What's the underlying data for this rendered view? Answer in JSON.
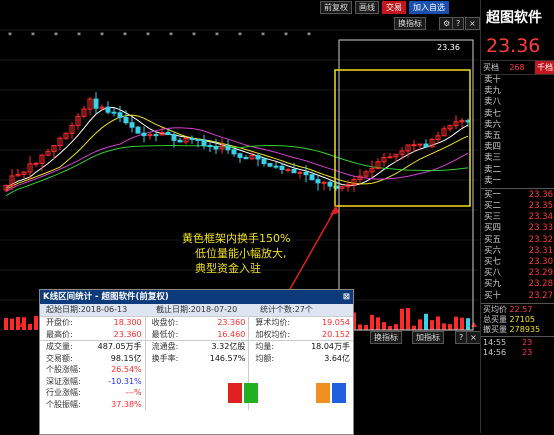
{
  "toolbar": {
    "fq": "前复权",
    "draw": "画线",
    "trade": "交易",
    "add_watch": "加入自选",
    "swap_top": "换指标",
    "swap_bottom": "换指标",
    "add_bottom": "加指标",
    "q": "?",
    "x": "×"
  },
  "chart": {
    "top_price": "23.36",
    "annotation_line1": "黄色框架内换手150%",
    "annotation_line2": "低位量能小幅放大,",
    "annotation_line3": "典型资金入驻"
  },
  "stock": {
    "name": "超图软件",
    "price": "23.36",
    "buy_label": "买档",
    "buy_count": "268",
    "buy_unit": "千档",
    "sells": [
      {
        "label": "卖十",
        "val": ""
      },
      {
        "label": "卖九",
        "val": ""
      },
      {
        "label": "卖八",
        "val": ""
      },
      {
        "label": "卖七",
        "val": ""
      },
      {
        "label": "卖六",
        "val": ""
      },
      {
        "label": "卖五",
        "val": ""
      },
      {
        "label": "卖四",
        "val": ""
      },
      {
        "label": "卖三",
        "val": ""
      },
      {
        "label": "卖二",
        "val": ""
      },
      {
        "label": "卖一",
        "val": ""
      }
    ],
    "buys": [
      {
        "label": "买一",
        "val": "23.36"
      },
      {
        "label": "买二",
        "val": "23.35"
      },
      {
        "label": "买三",
        "val": "23.34"
      },
      {
        "label": "买四",
        "val": "23.33"
      },
      {
        "label": "买五",
        "val": "23.32"
      },
      {
        "label": "买六",
        "val": "23.31"
      },
      {
        "label": "买七",
        "val": "23.30"
      },
      {
        "label": "买八",
        "val": "23.29"
      },
      {
        "label": "买九",
        "val": "23.28"
      },
      {
        "label": "买十",
        "val": "23.27"
      }
    ],
    "avg_buy_label": "买均价",
    "avg_buy": "22.57",
    "total_buy_label": "总买量",
    "total_buy": "27105",
    "withdraw_label": "撤买量",
    "withdraw": "278935",
    "ticks": [
      {
        "time": "14:55",
        "val": "23"
      },
      {
        "time": "14:56",
        "val": "23"
      }
    ]
  },
  "dialog": {
    "title": "K线区间统计 - 超图软件(前复权)",
    "start_date": "起始日期:2018-06-13",
    "end_date": "截止日期:2018-07-20",
    "count": "统计个数:27个",
    "col1": [
      {
        "k": "开盘价:",
        "v": "18.300",
        "c": "red"
      },
      {
        "k": "最高价:",
        "v": "23.360",
        "c": "red"
      },
      {
        "k": "成交量:",
        "v": "487.05万手",
        "c": "black"
      },
      {
        "k": "交易额:",
        "v": "98.15亿",
        "c": "black"
      },
      {
        "k": "个股涨幅:",
        "v": "26.54%",
        "c": "red"
      },
      {
        "k": "深证涨幅:",
        "v": "-10.31%",
        "c": "blue"
      },
      {
        "k": "行业涨幅:",
        "v": "---%",
        "c": "red"
      },
      {
        "k": "个股振幅:",
        "v": "37.38%",
        "c": "red"
      }
    ],
    "col2": [
      {
        "k": "收盘价:",
        "v": "23.360",
        "c": "red"
      },
      {
        "k": "最低价:",
        "v": "16.460",
        "c": "red"
      },
      {
        "k": "流通盘:",
        "v": "3.32亿股",
        "c": "black"
      },
      {
        "k": "换手率:",
        "v": "146.57%",
        "c": "black"
      }
    ],
    "col3": [
      {
        "k": "算术均价:",
        "v": "19.054",
        "c": "red"
      },
      {
        "k": "加权均价:",
        "v": "20.152",
        "c": "red"
      },
      {
        "k": "均量:",
        "v": "18.04万手",
        "c": "black"
      },
      {
        "k": "均额:",
        "v": "3.64亿",
        "c": "black"
      }
    ]
  }
}
